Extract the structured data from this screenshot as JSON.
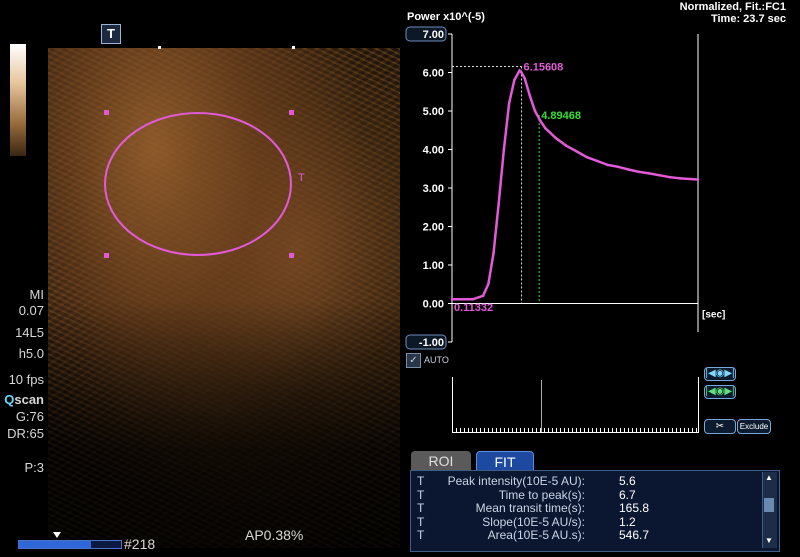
{
  "left_panel": {
    "t_button": "T",
    "roi_marker": "T",
    "params": [
      "MI",
      "0.07",
      "14L5",
      "h5.0",
      "10 fps"
    ],
    "qscan_q": "Q",
    "qscan_rest": "scan",
    "params2": [
      "G:76",
      "DR:65"
    ],
    "preset": "P:3",
    "frame_number": "#218",
    "ap_label": "AP0.38%",
    "progress_value": 0.72
  },
  "header": {
    "power_label": "Power x10^(-5)",
    "fit_label": "Normalized, Fit.:FC1",
    "time_label": "Time: 23.7 sec"
  },
  "chart_data": {
    "type": "line",
    "title": "",
    "ylabel": "Power x10^(-5)",
    "xlabel": "[sec]",
    "ylim": [
      -1.0,
      7.0
    ],
    "xlim": [
      0,
      23.7
    ],
    "yticks": [
      "7.00",
      "6.00",
      "5.00",
      "4.00",
      "3.00",
      "2.00",
      "1.00",
      "0.00",
      "-1.00"
    ],
    "ytick_values": [
      7,
      6,
      5,
      4,
      3,
      2,
      1,
      0,
      -1
    ],
    "annotations": [
      {
        "text": "6.15608",
        "x": 6.7,
        "y": 6.15608,
        "color": "#e35ad8"
      },
      {
        "text": "4.89468",
        "x": 8.4,
        "y": 4.89468,
        "color": "#33e033"
      },
      {
        "text": "0.11332",
        "x": 0.0,
        "y": 0.11332,
        "color": "#e35ad8"
      }
    ],
    "series": [
      {
        "color": "#e35ad8",
        "x": [
          0,
          1,
          2,
          3,
          3.5,
          4,
          4.5,
          5,
          5.5,
          6,
          6.5,
          6.7,
          7,
          7.5,
          8,
          8.5,
          9,
          10,
          11,
          12,
          13,
          14,
          15,
          16,
          17,
          18,
          19,
          20,
          21,
          22,
          23.7
        ],
        "values": [
          0.11,
          0.11,
          0.11,
          0.2,
          0.5,
          1.3,
          2.6,
          4.0,
          5.2,
          5.8,
          6.05,
          6.0,
          5.85,
          5.4,
          5.0,
          4.75,
          4.55,
          4.3,
          4.1,
          3.95,
          3.8,
          3.7,
          3.6,
          3.55,
          3.48,
          3.42,
          3.38,
          3.33,
          3.28,
          3.25,
          3.22
        ]
      }
    ]
  },
  "controls": {
    "auto_label": "AUTO",
    "exclude_label": "Exclude"
  },
  "tabs": [
    {
      "label": "ROI",
      "active": false
    },
    {
      "label": "FIT",
      "active": true
    }
  ],
  "fit_table": [
    {
      "prefix": "T",
      "label": "Peak intensity(10E-5 AU):",
      "value": "5.6"
    },
    {
      "prefix": "T",
      "label": "Time to peak(s):",
      "value": "6.7"
    },
    {
      "prefix": "T",
      "label": "Mean transit time(s):",
      "value": "165.8"
    },
    {
      "prefix": "T",
      "label": "Slope(10E-5 AU/s):",
      "value": "1.2"
    },
    {
      "prefix": "T",
      "label": "Area(10E-5 AU.s):",
      "value": "546.7"
    }
  ]
}
